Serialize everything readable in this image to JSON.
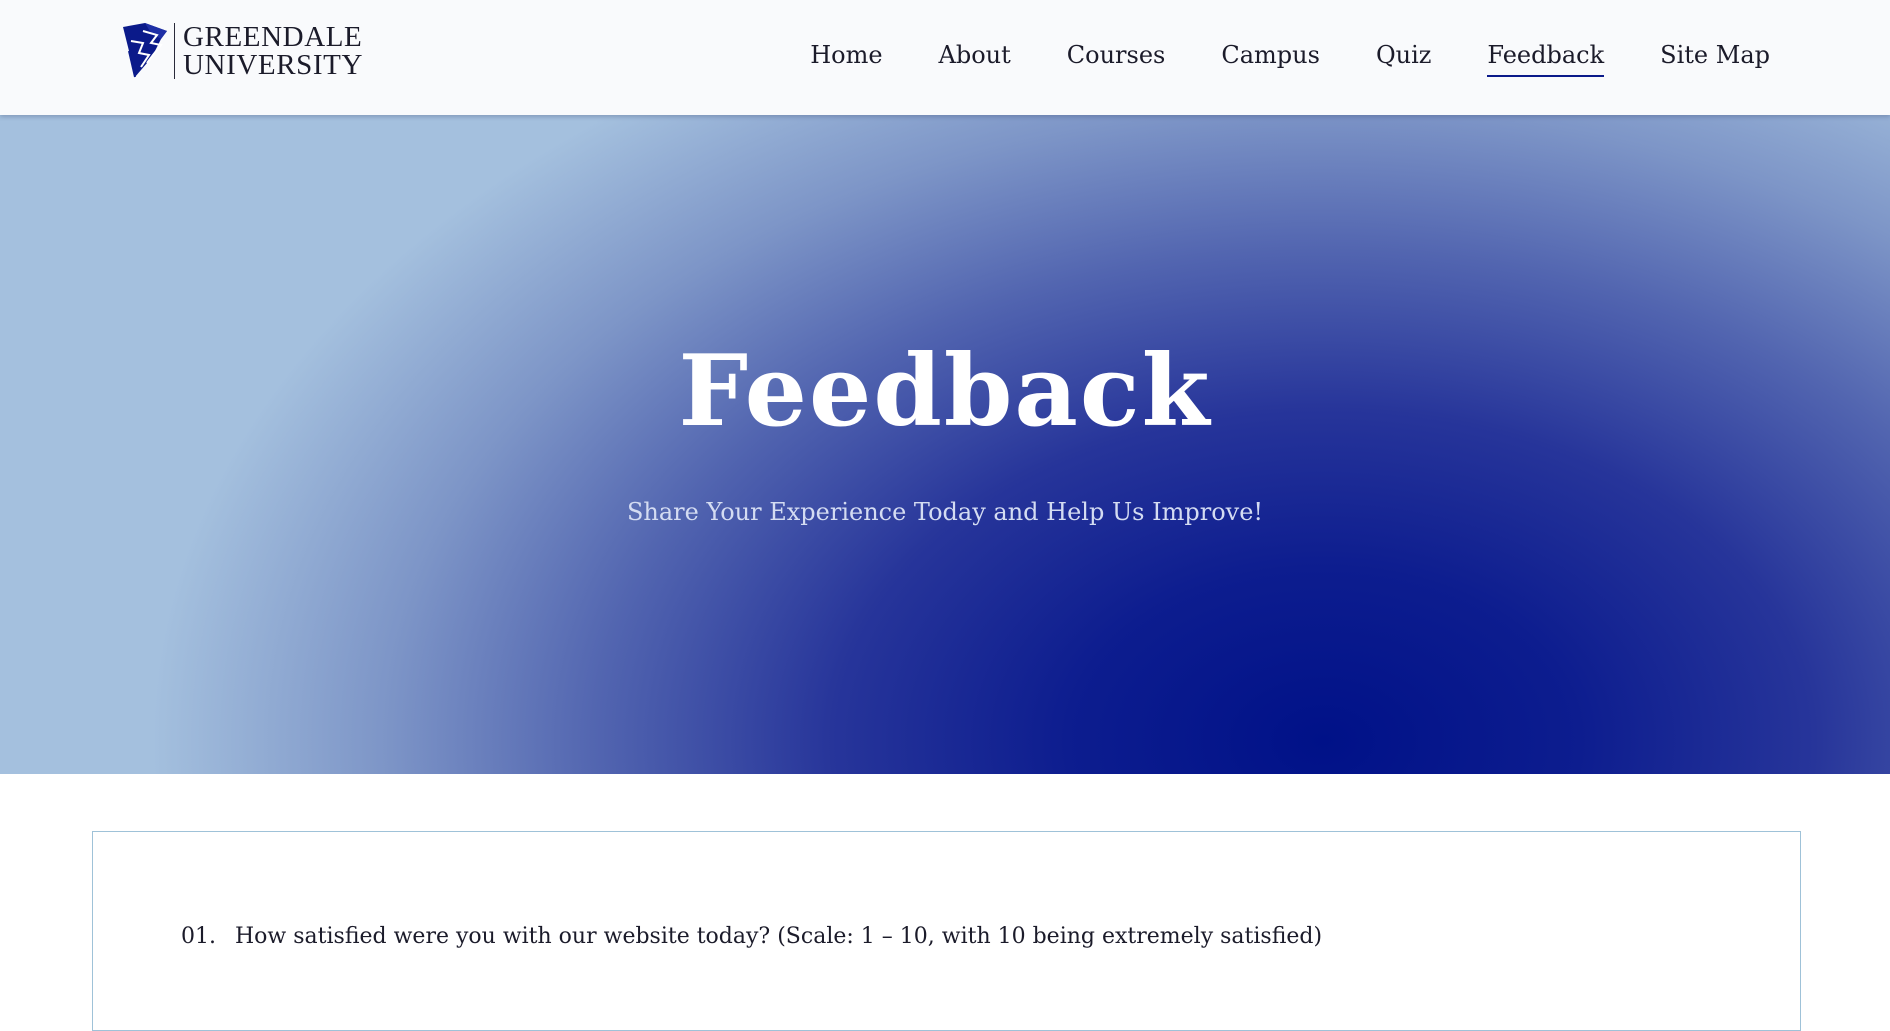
{
  "brand": {
    "line1": "GREENDALE",
    "line2": "UNIVERSITY",
    "color": "#0b1a8a"
  },
  "nav": {
    "items": [
      {
        "label": "Home"
      },
      {
        "label": "About"
      },
      {
        "label": "Courses"
      },
      {
        "label": "Campus"
      },
      {
        "label": "Quiz"
      },
      {
        "label": "Feedback",
        "active": true
      },
      {
        "label": "Site Map"
      }
    ]
  },
  "hero": {
    "title": "Feedback",
    "subtitle": "Share Your Experience Today and Help Us Improve!"
  },
  "form": {
    "questions": [
      {
        "number": "01.",
        "text": "How satisfied were you with our website today? (Scale: 1 – 10, with 10 being extremely satisfied)"
      }
    ]
  },
  "colors": {
    "hero_deep": "#001188",
    "hero_light": "#a4c0de",
    "card_border": "#9fc2d8",
    "nav_underline": "#0b1a8a"
  }
}
